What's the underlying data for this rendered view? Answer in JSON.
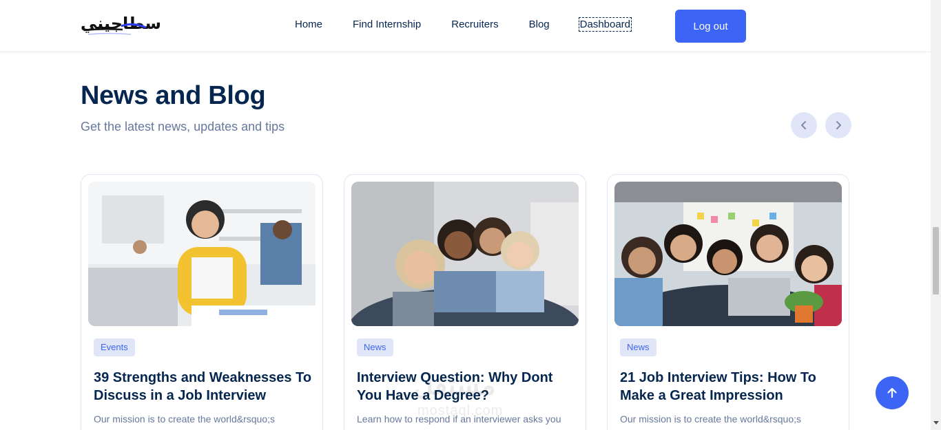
{
  "header": {
    "logo_text": "سطاجيني",
    "nav": [
      "Home",
      "Find Internship",
      "Recruiters",
      "Blog",
      "Dashboard"
    ],
    "logout_label": "Log out"
  },
  "section": {
    "title": "News and Blog",
    "subtitle": "Get the latest news, updates and tips"
  },
  "cards": [
    {
      "tag": "Events",
      "title": "39 Strengths and Weaknesses To Discuss in a Job Interview",
      "desc": "Our mission is to create the world&rsquo;s"
    },
    {
      "tag": "News",
      "title": "Interview Question: Why Dont You Have a Degree?",
      "desc": "Learn how to respond if an interviewer asks you"
    },
    {
      "tag": "News",
      "title": "21 Job Interview Tips: How To Make a Great Impression",
      "desc": "Our mission is to create the world&rsquo;s"
    }
  ],
  "watermark": {
    "text": "مستقل",
    "sub": "mostaql.com"
  },
  "icons": {
    "prev": "chevron-left-icon",
    "next": "chevron-right-icon",
    "scroll_top": "arrow-up-icon"
  },
  "colors": {
    "primary": "#3c65f5",
    "heading": "#05264e",
    "muted": "#66789c",
    "tag_bg": "#e0e6f7"
  }
}
